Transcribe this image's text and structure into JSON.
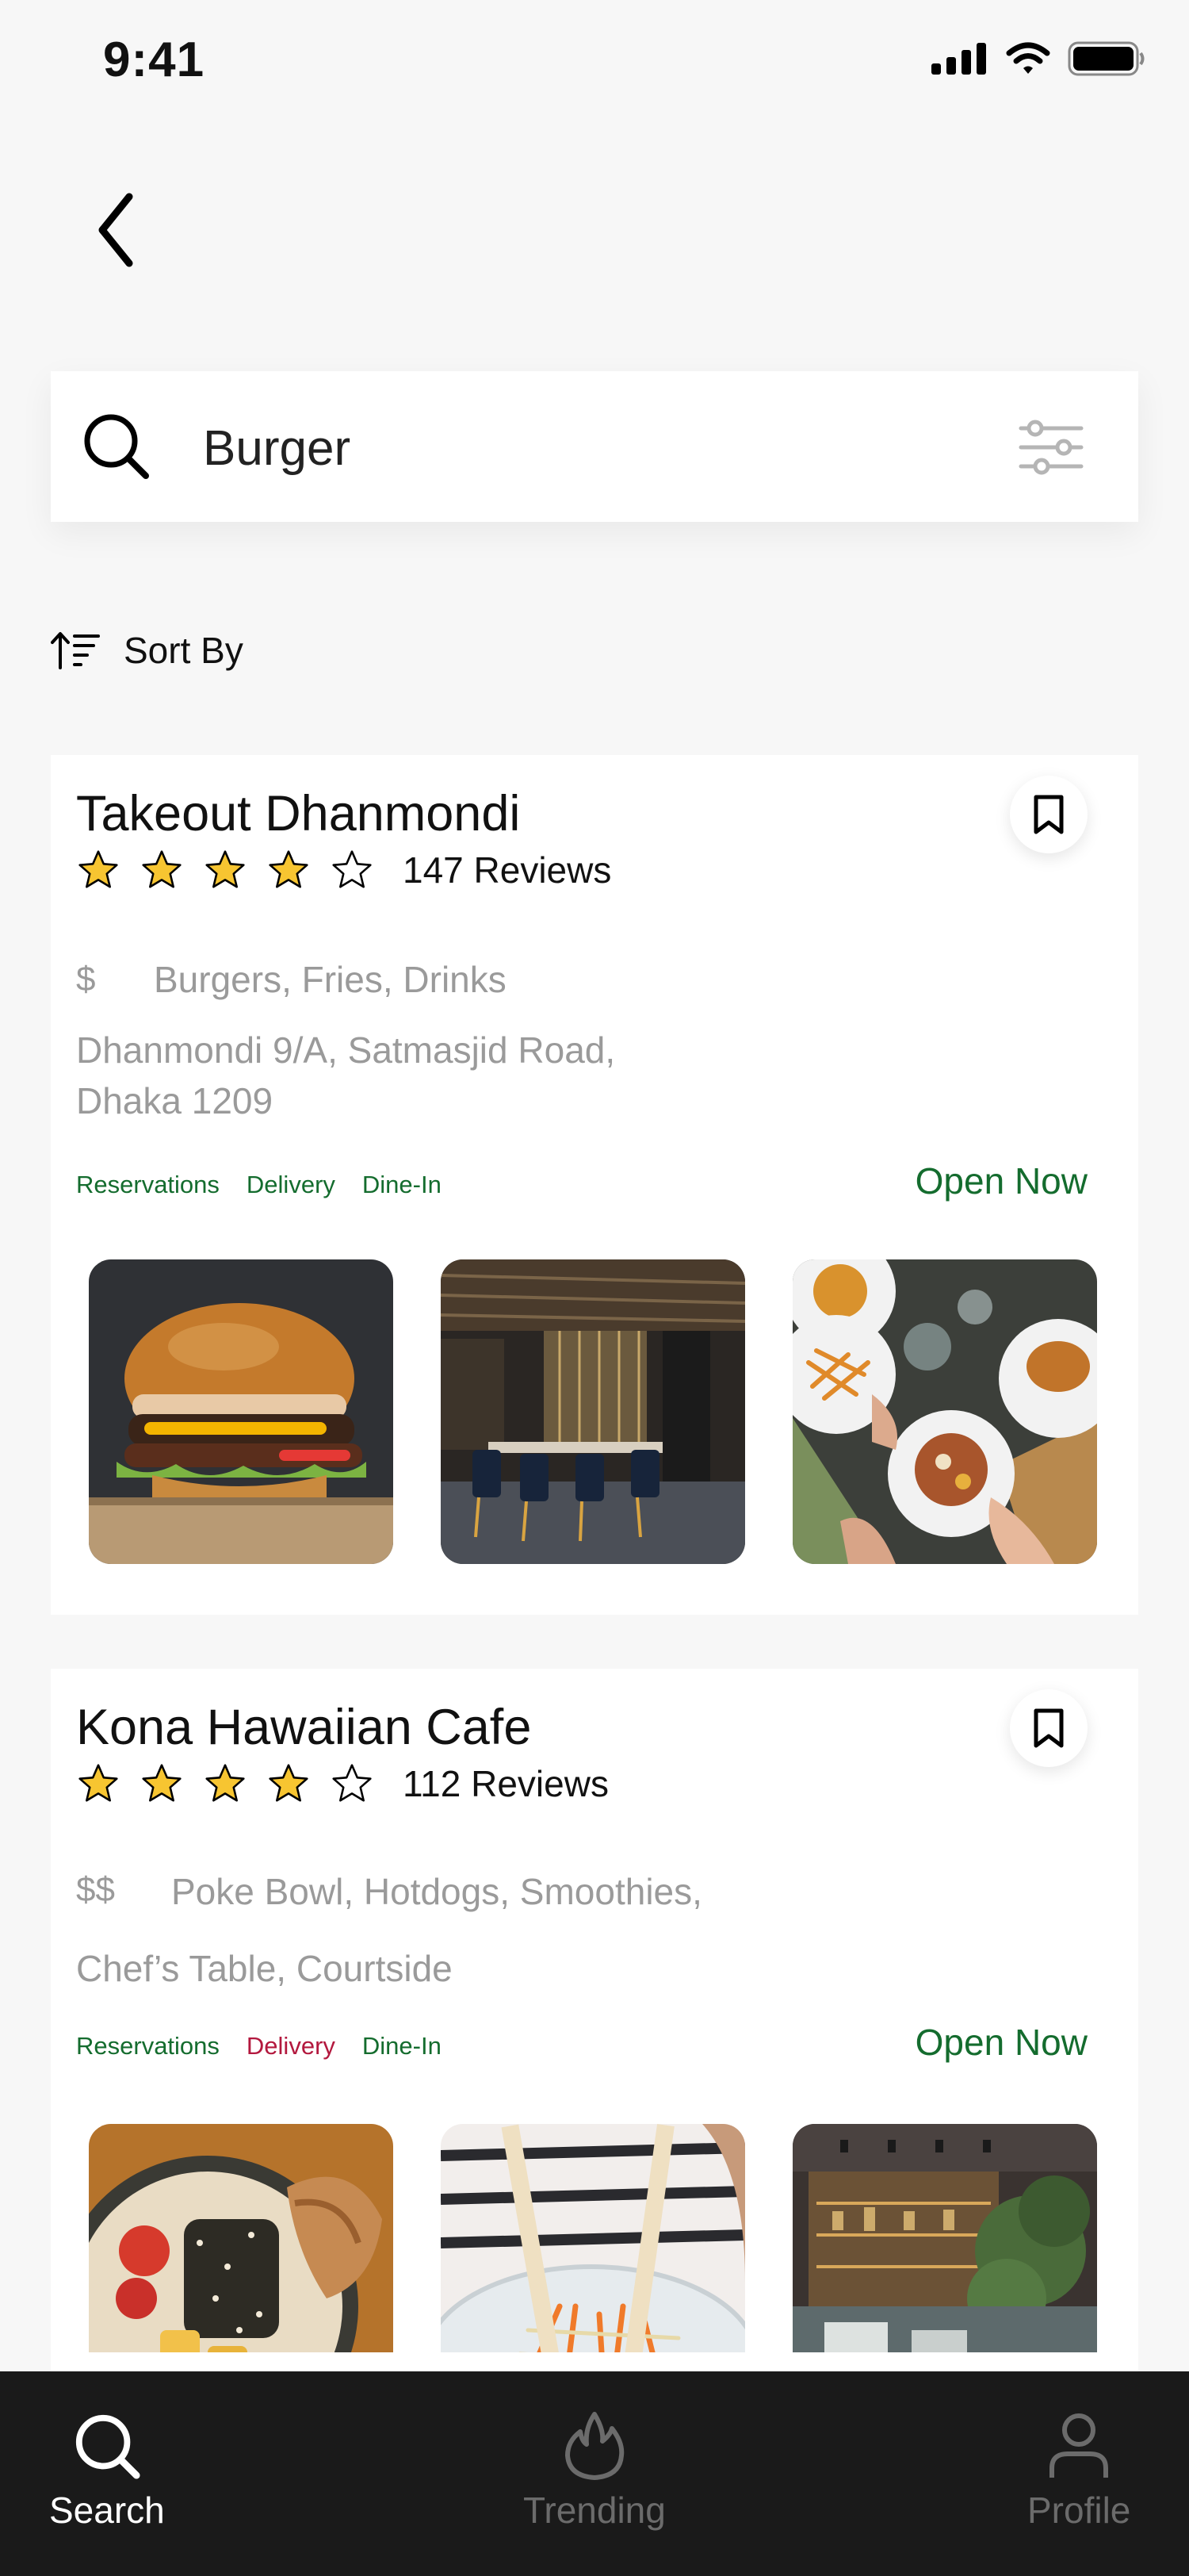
{
  "status_bar": {
    "time": "9:41"
  },
  "search": {
    "query": "Burger"
  },
  "sort": {
    "label": "Sort By"
  },
  "restaurants": [
    {
      "name": "Takeout Dhanmondi",
      "rating": 4,
      "reviews": "147 Reviews",
      "price": "$",
      "cuisine": "Burgers, Fries, Drinks",
      "address_line1": "Dhanmondi 9/A, Satmasjid Road,",
      "address_line2": "Dhaka 1209",
      "tags": [
        {
          "label": "Reservations",
          "color": "#146c2e"
        },
        {
          "label": "Delivery",
          "color": "#146c2e"
        },
        {
          "label": "Dine-In",
          "color": "#146c2e"
        }
      ],
      "status": "Open Now",
      "photos": [
        "burger-photo",
        "restaurant-interior-photo",
        "shared-meal-photo"
      ]
    },
    {
      "name": "Kona Hawaiian Cafe",
      "rating": 4,
      "reviews": "112 Reviews",
      "price": "$$",
      "cuisine": "Poke Bowl, Hotdogs, Smoothies,",
      "address_line1": "Chef’s Table, Courtside",
      "tags": [
        {
          "label": "Reservations",
          "color": "#146c2e"
        },
        {
          "label": "Delivery",
          "color": "#b3183e"
        },
        {
          "label": "Dine-In",
          "color": "#146c2e"
        }
      ],
      "status": "Open Now",
      "photos": [
        "poke-bowl-photo",
        "noodle-salad-photo",
        "cafe-interior-photo"
      ]
    }
  ],
  "tab_bar": {
    "tabs": [
      {
        "label": "Search",
        "icon": "search-icon",
        "active": true
      },
      {
        "label": "Trending",
        "icon": "flame-icon",
        "active": false
      },
      {
        "label": "Profile",
        "icon": "person-icon",
        "active": false
      }
    ]
  },
  "colors": {
    "accent_green": "#146c2e",
    "accent_red": "#b3183e",
    "star_yellow": "#f7c531",
    "tab_bar_bg": "#1a1a1a"
  }
}
